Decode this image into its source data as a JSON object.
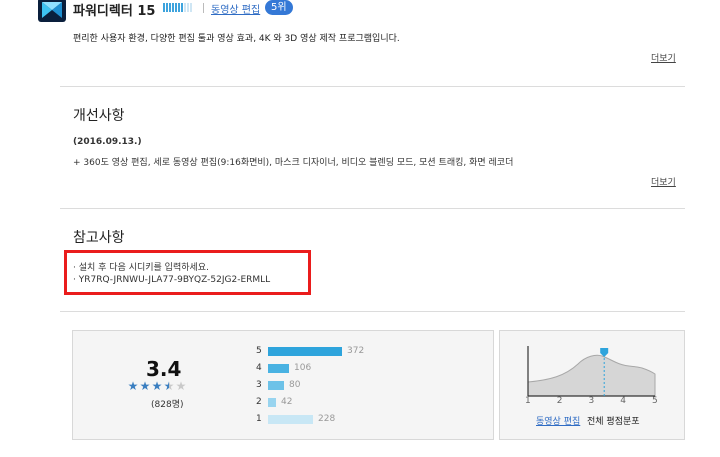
{
  "header": {
    "title": "파워디렉터 15",
    "rating_level": 0.7,
    "category_link": "동영상 편집",
    "rank_badge": "5위"
  },
  "description": {
    "text": "편리한 사용자 환경, 다양한 편집 툴과 영상 효과, 4K 와 3D 영상 제작 프로그램입니다.",
    "more_label": "더보기"
  },
  "improvements": {
    "title": "개선사항",
    "date": "(2016.09.13.)",
    "items": [
      "+ 360도 영상 편집, 세로 동영상 편집(9:16화면비), 마스크 디자이너, 비디오 블렌딩 모드, 모션 트래킹, 화면 레코더"
    ],
    "more_label": "더보기"
  },
  "notes": {
    "title": "참고사항",
    "items": [
      "· 설치 후 다음 시디키를 입력하세요.",
      "· YR7RQ-JRNWU-JLA77-9BYQZ-52JG2-ERMLL"
    ]
  },
  "rating": {
    "score": "3.4",
    "stars": 3.4,
    "votes": "(828명)",
    "distribution": [
      {
        "star": "5",
        "count": "372",
        "value": 372
      },
      {
        "star": "4",
        "count": "106",
        "value": 106
      },
      {
        "star": "3",
        "count": "80",
        "value": 80
      },
      {
        "star": "2",
        "count": "42",
        "value": 42
      },
      {
        "star": "1",
        "count": "228",
        "value": 228
      }
    ],
    "bar_colors": [
      "#2ea4dc",
      "#49b2e2",
      "#6dc2e8",
      "#98d4ef",
      "#c8e7f5"
    ]
  },
  "chart_data": {
    "type": "area",
    "x": [
      1,
      2,
      3,
      4,
      5
    ],
    "xlim": [
      1,
      5
    ],
    "marker_x": 3.4,
    "tick_labels": [
      "1",
      "2",
      "3",
      "4",
      "5"
    ],
    "link_label": "동영상 편집",
    "caption": "전체 평점분포"
  }
}
